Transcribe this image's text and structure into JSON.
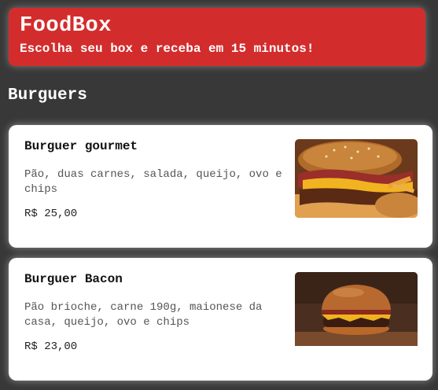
{
  "header": {
    "title": "FoodBox",
    "subtitle": "Escolha seu box e receba em 15 minutos!",
    "color": "#d32c2c"
  },
  "section": {
    "title": "Burguers"
  },
  "products": [
    {
      "name": "Burguer gourmet",
      "description": "Pão, duas carnes, salada, queijo, ovo e chips",
      "price": "R$ 25,00",
      "image": "burger-gourmet-photo"
    },
    {
      "name": "Burguer Bacon",
      "description": "Pão brioche, carne 190g, maionese da casa, queijo, ovo e chips",
      "price": "R$ 23,00",
      "image": "burger-bacon-photo"
    }
  ]
}
